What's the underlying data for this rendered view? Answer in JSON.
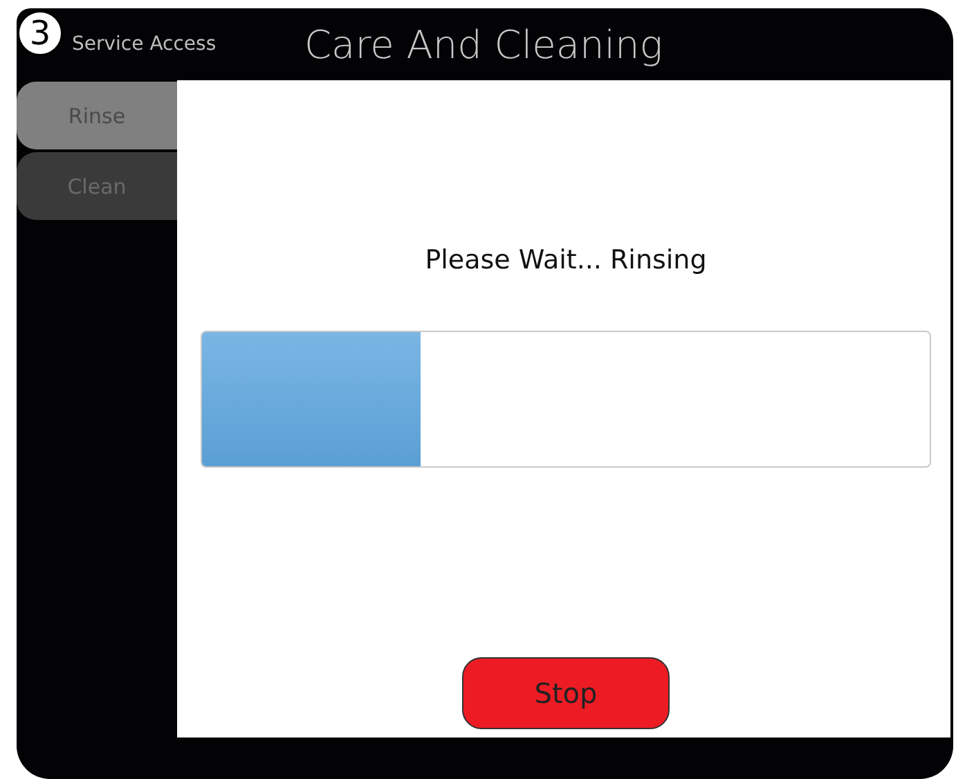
{
  "step_badge": "3",
  "header": {
    "back_label": "Service Access",
    "title": "Care And Cleaning"
  },
  "tabs": [
    {
      "label": "Rinse",
      "selected": true
    },
    {
      "label": "Clean",
      "selected": false
    }
  ],
  "status_text": "Please Wait... Rinsing",
  "progress": {
    "level": 0.3
  },
  "buttons": [
    {
      "label": "Stop"
    }
  ]
}
